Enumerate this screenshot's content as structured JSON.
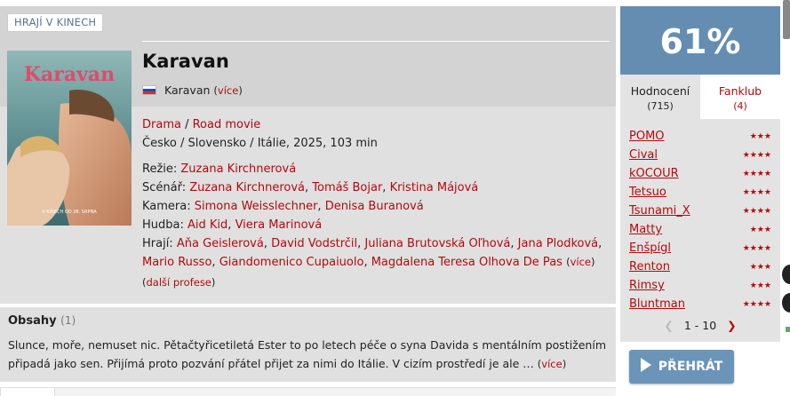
{
  "badge": "HRAJÍ V KINECH",
  "movie": {
    "title": "Karavan",
    "original_title": "Karavan",
    "original_more": "více",
    "poster_title": "Karavan",
    "poster_text": "V KINECH OD 28. SRPNA",
    "genres": [
      "Drama",
      "Road movie"
    ],
    "origin": "Česko / Slovensko / Itálie, 2025, 103 min",
    "director_label": "Režie:",
    "director": "Zuzana Kirchnerová",
    "writers_label": "Scénář:",
    "writers": [
      "Zuzana Kirchnerová",
      "Tomáš Bojar",
      "Kristina Májová"
    ],
    "camera_label": "Kamera:",
    "camera": [
      "Simona Weisslechner",
      "Denisa Buranová"
    ],
    "music_label": "Hudba:",
    "music": [
      "Aid Kid",
      "Viera Marinová"
    ],
    "cast_label": "Hrají:",
    "cast_line1": [
      "Aňa Geislerová",
      "David Vodstrčil",
      "Juliana Brutovská Oľhová",
      "Jana Plodková"
    ],
    "cast_line2": [
      "Mario Russo",
      "Giandomenico Cupaiuolo",
      "Magdalena Teresa Olhova De Pas"
    ],
    "cast_more": "více",
    "more_professions": "další profese"
  },
  "plot": {
    "title": "Obsahy",
    "count": "(1)",
    "text": "Slunce, moře, nemuset nic. Pětačtyřicetiletá Ester to po letech péče o syna Davida s mentálním postižením připadá jako sen. Přijímá proto pozvání přátel přijet za nimi do Itálie. V cizím prostředí je ale …",
    "more": "více"
  },
  "rating": {
    "score": "61%",
    "tab_ratings": "Hodnocení",
    "tab_ratings_count": "(715)",
    "tab_fanclub": "Fanklub",
    "tab_fanclub_count": "(4)",
    "users": [
      {
        "name": "POMO",
        "stars": 3
      },
      {
        "name": "Cival",
        "stars": 4
      },
      {
        "name": "kOCOUR",
        "stars": 4
      },
      {
        "name": "Tetsuo",
        "stars": 4
      },
      {
        "name": "Tsunami_X",
        "stars": 4
      },
      {
        "name": "Matty",
        "stars": 3
      },
      {
        "name": "Enšpígl",
        "stars": 4
      },
      {
        "name": "Renton",
        "stars": 3
      },
      {
        "name": "Rimsy",
        "stars": 3
      },
      {
        "name": "Bluntman",
        "stars": 4
      }
    ],
    "pager": "1 - 10"
  },
  "play_button": "PŘEHRÁT",
  "colors": {
    "link": "#b3090d",
    "score_bg": "#658db2",
    "panel_bg": "#e0e0e0",
    "play_bg": "#6a94b8"
  }
}
